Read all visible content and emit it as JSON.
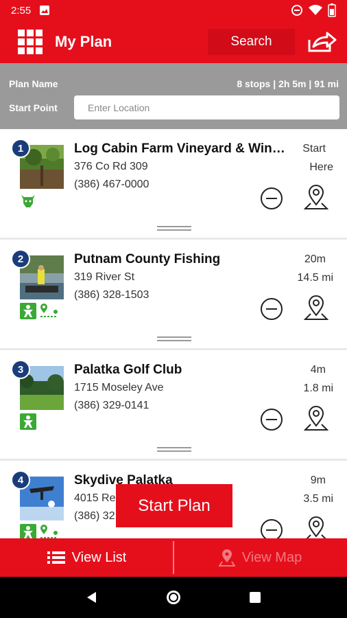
{
  "status_bar": {
    "time": "2:55"
  },
  "app_bar": {
    "title": "My Plan",
    "search_label": "Search"
  },
  "plan": {
    "name_label": "Plan Name",
    "stats": "8 stops | 2h 5m | 91 mi",
    "start_label": "Start Point",
    "location_placeholder": "Enter Location"
  },
  "stops": [
    {
      "number": "1",
      "name": "Log Cabin Farm Vineyard & Winery",
      "address": "376 Co Rd 309",
      "phone": "(386) 467-0000",
      "line1": "Start",
      "line2": "Here",
      "category_icons": [
        "cow-icon"
      ]
    },
    {
      "number": "2",
      "name": "Putnam County Fishing",
      "address": "319 River St",
      "phone": "(386) 328-1503",
      "line1": "20m",
      "line2": "14.5 mi",
      "category_icons": [
        "activity-icon",
        "location-route-icon"
      ]
    },
    {
      "number": "3",
      "name": "Palatka Golf Club",
      "address": "1715 Moseley Ave",
      "phone": "(386) 329-0141",
      "line1": "4m",
      "line2": "1.8 mi",
      "category_icons": [
        "activity-icon"
      ]
    },
    {
      "number": "4",
      "name": "Skydive Palatka",
      "address": "4015 Re",
      "phone": "(386) 32",
      "line1": "9m",
      "line2": "3.5 mi",
      "category_icons": [
        "activity-icon",
        "location-route-icon"
      ]
    }
  ],
  "start_plan_label": "Start Plan",
  "bottom_tabs": {
    "list_label": "View List",
    "map_label": "View Map"
  },
  "colors": {
    "brand_red": "#e50f1c",
    "badge_blue": "#1b3c7a",
    "category_green": "#3aa935",
    "plan_bar_gray": "#9a9a9a"
  }
}
